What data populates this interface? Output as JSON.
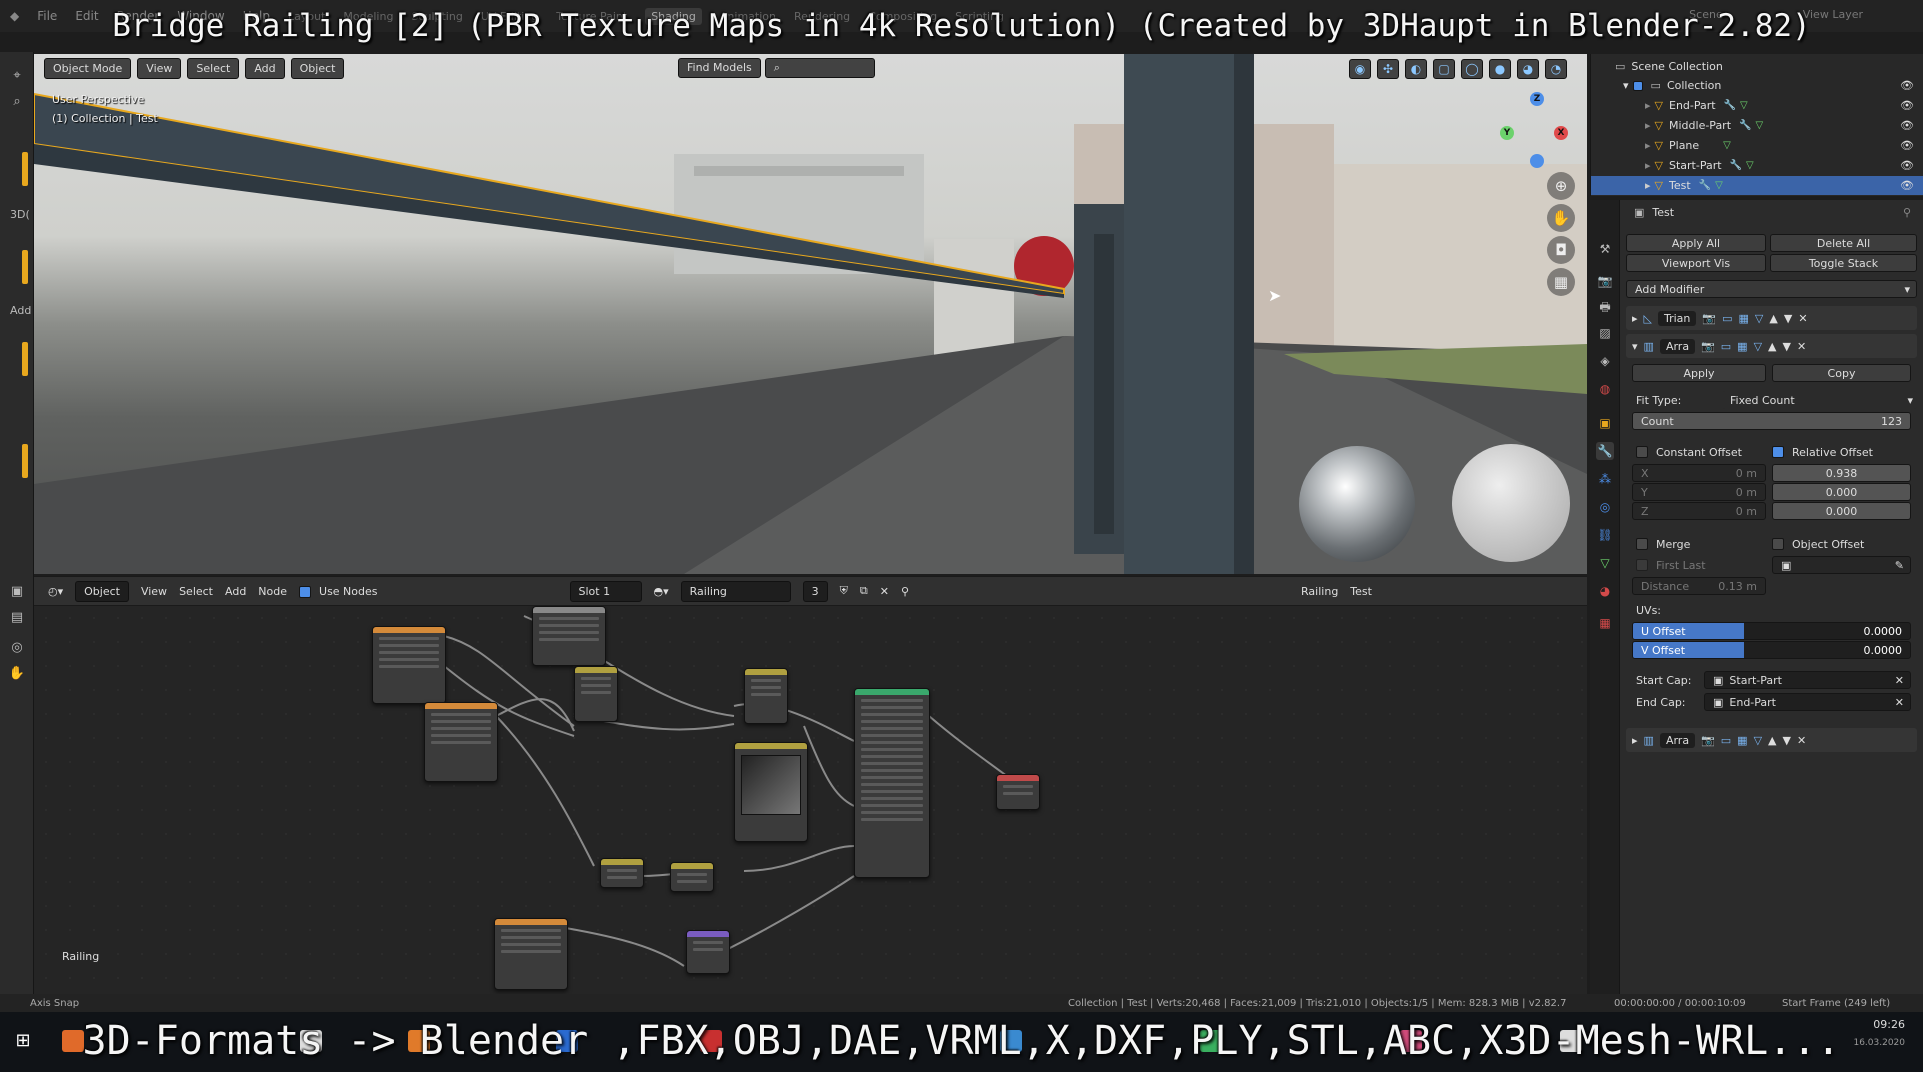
{
  "overlay": {
    "title": "Bridge Railing [2] (PBR Texture Maps in 4k Resolution) (Created by 3DHaupt in Blender-2.82)",
    "caption": "3D-Formats -> Blender ,FBX,OBJ,DAE,VRML,X,DXF,PLY,STL,ABC,X3D-Mesh-WRL..."
  },
  "topbar": {
    "menus": [
      "File",
      "Edit",
      "Render",
      "Window",
      "Help"
    ],
    "workspaces": [
      "Layout",
      "Modeling",
      "Sculpting",
      "UV Editing",
      "Texture Paint",
      "Shading",
      "Animation",
      "Rendering",
      "Compositing",
      "Scripting"
    ],
    "active_workspace": "Shading",
    "scene": "Scene",
    "view_layer": "View Layer"
  },
  "viewport": {
    "mode": "Object Mode",
    "menus": [
      "View",
      "Select",
      "Add",
      "Object"
    ],
    "find_models": "Find Models",
    "info_line1": "User Perspective",
    "info_line2": "(1) Collection | Test",
    "left_labels": [
      "3D(",
      "Add"
    ]
  },
  "node_editor": {
    "editor_type": "Object",
    "menus": [
      "View",
      "Select",
      "Add",
      "Node"
    ],
    "use_nodes": "Use Nodes",
    "slot": "Slot 1",
    "material": "Railing",
    "users": "3",
    "material_right": "Railing",
    "object_right": "Test",
    "canvas_label": "Railing"
  },
  "outliner": {
    "root": "Scene Collection",
    "collection": "Collection",
    "items": [
      "End-Part",
      "Middle-Part",
      "Plane",
      "Start-Part",
      "Test"
    ],
    "selected": "Test"
  },
  "properties": {
    "object_name": "Test",
    "apply_all": "Apply All",
    "delete_all": "Delete All",
    "viewport_vis": "Viewport Vis",
    "toggle_stack": "Toggle Stack",
    "add_modifier": "Add Modifier",
    "modifier1_name": "Trian",
    "modifier2_name": "Arra",
    "modifier3_name": "Arra",
    "apply": "Apply",
    "copy": "Copy",
    "fit_type_label": "Fit Type:",
    "fit_type_value": "Fixed Count",
    "count_label": "Count",
    "count_value": "123",
    "constant_offset": "Constant Offset",
    "relative_offset": "Relative Offset",
    "x_label": "X",
    "y_label": "Y",
    "z_label": "Z",
    "const_x": "0 m",
    "const_y": "0 m",
    "const_z": "0 m",
    "rel_x": "0.938",
    "rel_y": "0.000",
    "rel_z": "0.000",
    "merge": "Merge",
    "object_offset": "Object Offset",
    "first_last": "First Last",
    "distance_label": "Distance",
    "distance_value": "0.13 m",
    "uvs_label": "UVs:",
    "u_offset_label": "U Offset",
    "u_offset_value": "0.0000",
    "v_offset_label": "V Offset",
    "v_offset_value": "0.0000",
    "start_cap_label": "Start Cap:",
    "start_cap_value": "Start-Part",
    "end_cap_label": "End Cap:",
    "end_cap_value": "End-Part"
  },
  "statusbar": {
    "left": "Axis Snap",
    "stats": "Collection | Test | Verts:20,468 | Faces:21,009 | Tris:21,010 | Objects:1/5 | Mem: 828.3 MiB | v2.82.7",
    "time": "00:00:00:00 / 00:00:10:09",
    "frame": "Start Frame (249 left)"
  },
  "taskbar": {
    "time": "09:26",
    "date": "16.03.2020"
  },
  "colors": {
    "accent_blue": "#4d8ee8",
    "selection_orange": "#e8a81e",
    "selected_row": "#3b64a8"
  }
}
